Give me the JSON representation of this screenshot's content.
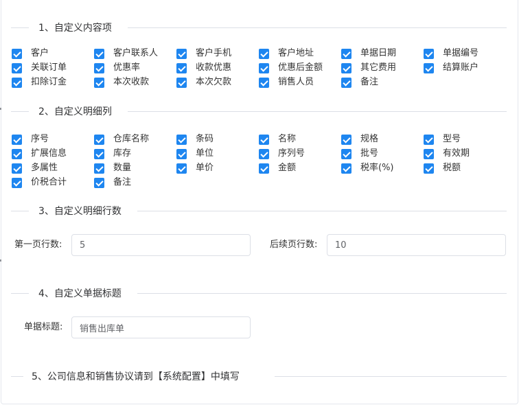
{
  "section1": {
    "title": "1、自定义内容项",
    "rows": [
      [
        "客户",
        "客户联系人",
        "客户手机",
        "客户地址",
        "单据日期",
        "单据编号"
      ],
      [
        "关联订单",
        "优惠率",
        "收款优惠",
        "优惠后金额",
        "其它费用",
        "结算账户"
      ],
      [
        "扣除订金",
        "本次收款",
        "本次欠款",
        "销售人员",
        "备注"
      ]
    ]
  },
  "section2": {
    "title": "2、自定义明细列",
    "rows": [
      [
        "序号",
        "仓库名称",
        "条码",
        "名称",
        "规格",
        "型号"
      ],
      [
        "扩展信息",
        "库存",
        "单位",
        "序列号",
        "批号",
        "有效期"
      ],
      [
        "多属性",
        "数量",
        "单价",
        "金额",
        "税率(%)",
        "税额"
      ],
      [
        "价税合计",
        "备注"
      ]
    ]
  },
  "section3": {
    "title": "3、自定义明细行数",
    "first_page_label": "第一页行数:",
    "first_page_value": "5",
    "next_page_label": "后续页行数:",
    "next_page_value": "10"
  },
  "section4": {
    "title": "4、自定义单据标题",
    "bill_title_label": "单据标题:",
    "bill_title_value": "销售出库单"
  },
  "section5": {
    "title": "5、公司信息和销售协议请到【系统配置】中填写"
  },
  "colors": {
    "accent": "#1e86f0",
    "line": "#dcdfe6"
  }
}
